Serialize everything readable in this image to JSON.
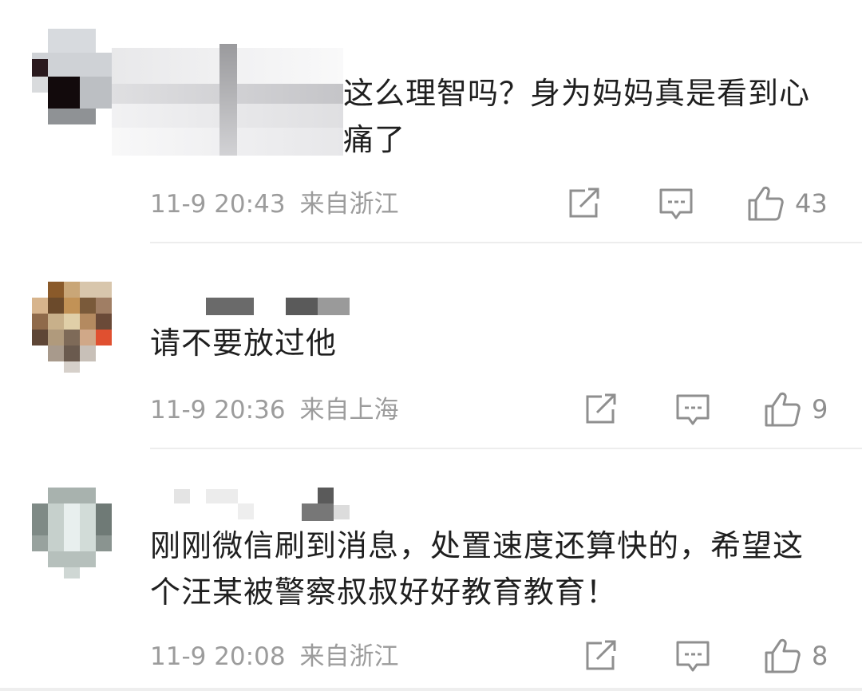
{
  "comments": [
    {
      "text": "这么理智吗？身为妈妈真是看到心痛了",
      "time": "11-9 20:43",
      "location": "来自浙江",
      "likes": "43"
    },
    {
      "text": "请不要放过他",
      "time": "11-9 20:36",
      "location": "来自上海",
      "likes": "9"
    },
    {
      "text": "刚刚微信刷到消息，处置速度还算快的，希望这个汪某被警察叔叔好好教育教育！",
      "time": "11-9 20:08",
      "location": "来自浙江",
      "likes": "8"
    }
  ],
  "icons": {
    "share": "share-icon",
    "reply": "comment-icon",
    "like": "thumbs-up-icon"
  },
  "colors": {
    "text": "#1f1f1f",
    "meta": "#9c9c9c",
    "icon": "#8f8f8f",
    "divider": "#ededed"
  }
}
